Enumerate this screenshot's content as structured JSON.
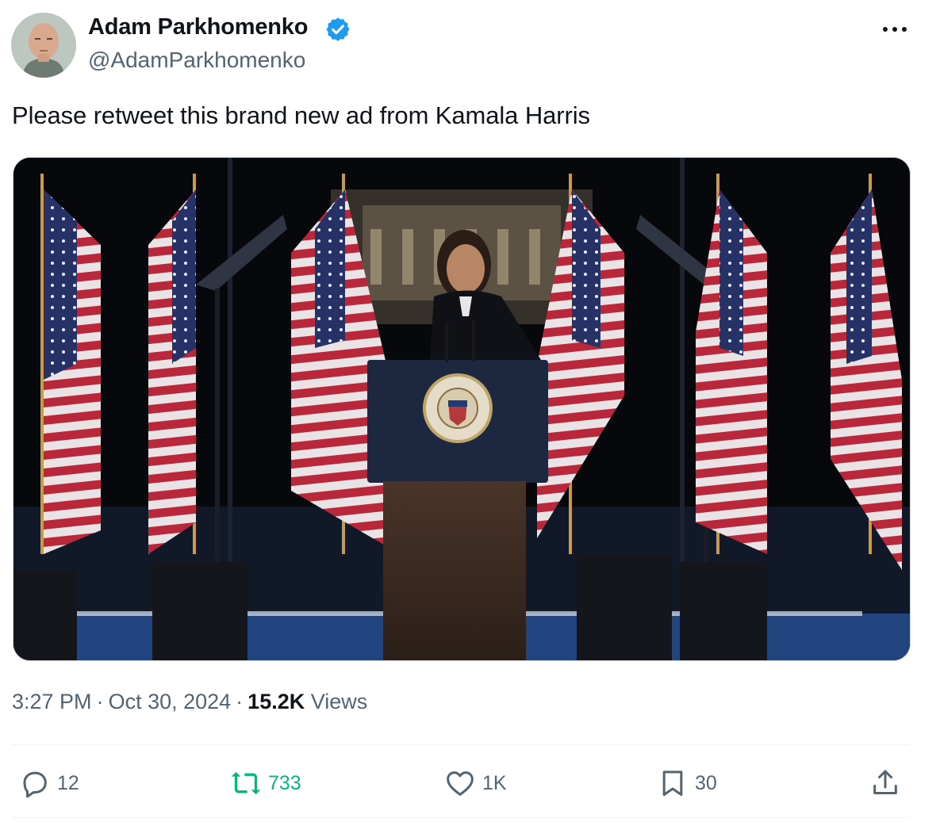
{
  "author": {
    "display_name": "Adam Parkhomenko",
    "handle": "@AdamParkhomenko",
    "verified_icon": "verified-badge-icon",
    "verified_color": "#1d9bf0"
  },
  "post": {
    "text": "Please retweet this brand new ad from Kamala Harris"
  },
  "media": {
    "type": "video-frame",
    "podium_seal_text": "VICE PRESIDENT OF THE UNITED STATES"
  },
  "meta": {
    "time": "3:27 PM",
    "date": "Oct 30, 2024",
    "separator": "·",
    "views_count": "15.2K",
    "views_label": "Views"
  },
  "actions": {
    "replies": "12",
    "reposts": "733",
    "likes": "1K",
    "bookmarks": "30",
    "repost_color": "#00ba7c",
    "icons": [
      "reply-icon",
      "repost-icon",
      "like-icon",
      "bookmark-icon",
      "share-icon"
    ]
  },
  "more_icon": "more-options-icon"
}
